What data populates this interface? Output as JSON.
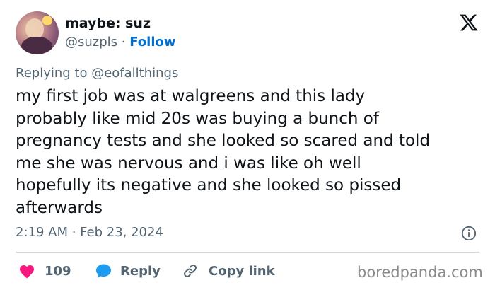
{
  "author": {
    "display_name": "maybe: suz",
    "handle": "@suzpls",
    "separator": " · ",
    "follow_label": "Follow"
  },
  "reply_context": {
    "prefix": "Replying to ",
    "target": "@eofallthings"
  },
  "tweet": {
    "text": "my first job was at walgreens and this lady\nprobably like mid 20s was buying a bunch of\npregnancy tests and she looked so scared and told\nme she was nervous and i was like oh well\nhopefully its negative and she looked so pissed\nafterwards",
    "timestamp": "2:19 AM · Feb 23, 2024"
  },
  "actions": {
    "like_count": "109",
    "reply_label": "Reply",
    "copy_link_label": "Copy link"
  },
  "watermark": "boredpanda.com",
  "icons": {
    "brand": "x-logo-icon",
    "info": "info-icon",
    "like": "heart-icon",
    "reply": "chat-bubble-icon",
    "copy": "link-icon"
  },
  "colors": {
    "heart": "#f91880",
    "reply_bubble": "#1d9bf0",
    "follow": "#006fd6",
    "secondary_text": "#536471"
  }
}
